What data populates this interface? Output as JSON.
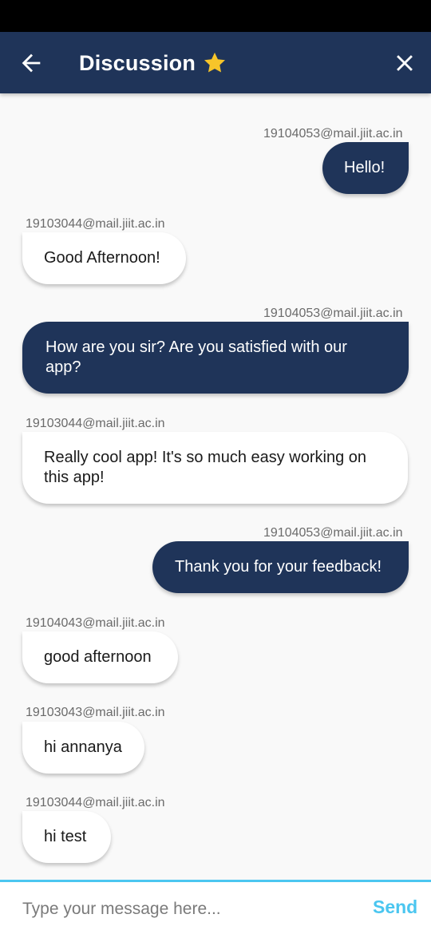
{
  "header": {
    "title": "Discussion",
    "back_icon": "arrow-left-icon",
    "star_icon": "star-icon",
    "close_icon": "close-icon",
    "background_color": "#1f3459",
    "star_color": "#f7c52a"
  },
  "messages": [
    {
      "sender": "19104053@mail.jiit.ac.in",
      "text_lines": [
        "Hello!"
      ],
      "direction": "outgoing"
    },
    {
      "sender": "19103044@mail.jiit.ac.in",
      "text_lines": [
        "Good Afternoon!"
      ],
      "direction": "incoming"
    },
    {
      "sender": "19104053@mail.jiit.ac.in",
      "text_lines": [
        "How are you sir? Are you satisfied with our",
        "app?"
      ],
      "direction": "outgoing"
    },
    {
      "sender": "19103044@mail.jiit.ac.in",
      "text_lines": [
        "Really cool app! It's so much easy working on",
        "this app!"
      ],
      "direction": "incoming"
    },
    {
      "sender": "19104053@mail.jiit.ac.in",
      "text_lines": [
        "Thank you for your feedback!"
      ],
      "direction": "outgoing"
    },
    {
      "sender": "19104043@mail.jiit.ac.in",
      "text_lines": [
        "good afternoon"
      ],
      "direction": "incoming"
    },
    {
      "sender": "19103043@mail.jiit.ac.in",
      "text_lines": [
        "hi annanya"
      ],
      "direction": "incoming"
    },
    {
      "sender": "19103044@mail.jiit.ac.in",
      "text_lines": [
        "hi test"
      ],
      "direction": "incoming"
    }
  ],
  "composer": {
    "placeholder": "Type your message here...",
    "value": "",
    "send_label": "Send",
    "accent_color": "#4bc6f0"
  }
}
